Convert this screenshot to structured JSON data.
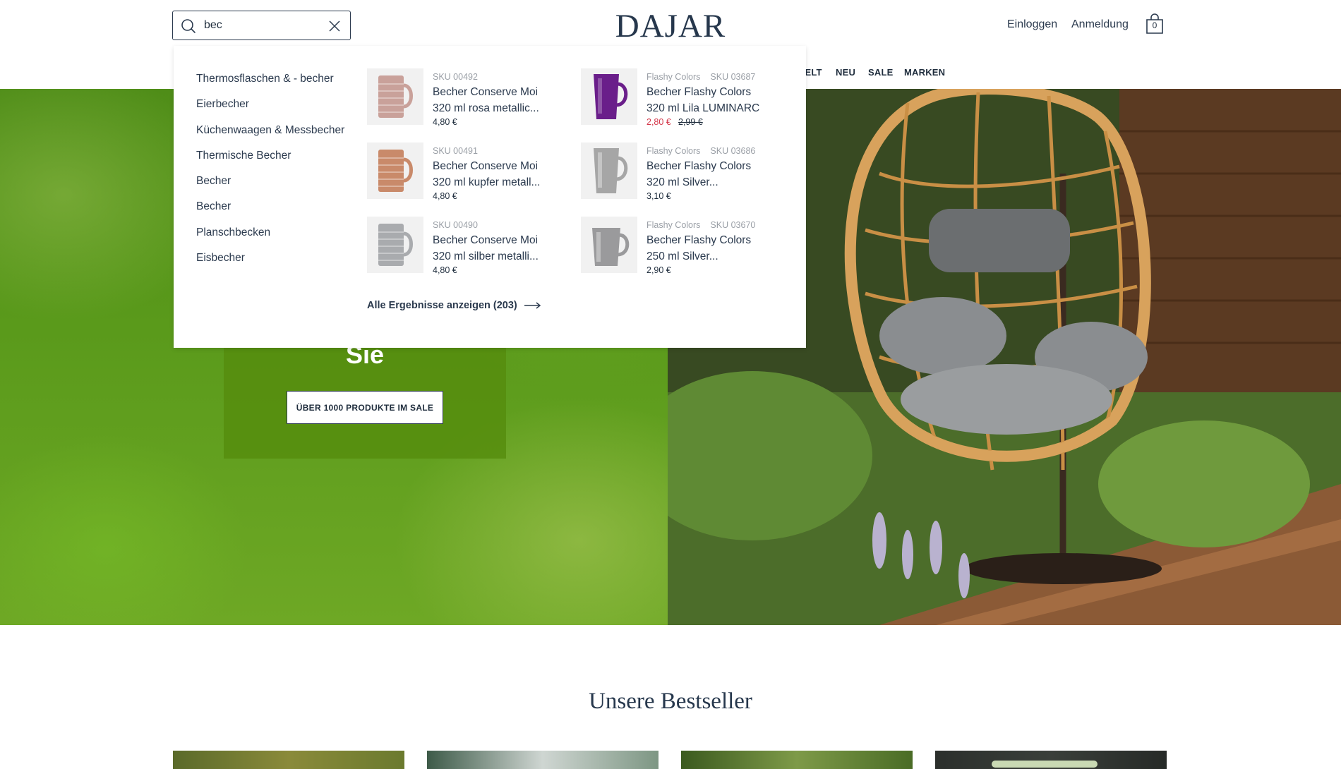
{
  "header": {
    "logo": "DAJAR",
    "search": {
      "value": "bec",
      "placeholder": ""
    },
    "login_label": "Einloggen",
    "register_label": "Anmeldung",
    "cart_count": "0",
    "nav": {
      "welt": "WELT",
      "neu": "NEU",
      "sale": "SALE",
      "marken": "MARKEN"
    }
  },
  "dropdown": {
    "categories": [
      "Thermosflaschen & - becher",
      "Eierbecher",
      "Küchenwaagen & Messbecher",
      "Thermische Becher",
      "Becher",
      "Becher",
      "Planschbecken",
      "Eisbecher"
    ],
    "products": [
      {
        "meta1": "SKU 00492",
        "meta2": "",
        "name": "Becher Conserve Moi 320 ml rosa metallic...",
        "price": "4,80 €",
        "old_price": "",
        "color": "#c9a19a"
      },
      {
        "meta1": "SKU 00491",
        "meta2": "",
        "name": "Becher Conserve Moi 320 ml kupfer metall...",
        "price": "4,80 €",
        "old_price": "",
        "color": "#c98a6a"
      },
      {
        "meta1": "SKU 00490",
        "meta2": "",
        "name": "Becher Conserve Moi 320 ml silber metalli...",
        "price": "4,80 €",
        "old_price": "",
        "color": "#a9abae"
      },
      {
        "meta1": "Flashy Colors",
        "meta2": "SKU 03687",
        "name": "Becher Flashy Colors 320 ml Lila LUMINARC",
        "price": "2,80 €",
        "old_price": "2,99 €",
        "color": "#6a1e8a"
      },
      {
        "meta1": "Flashy Colors",
        "meta2": "SKU 03686",
        "name": "Becher Flashy Colors 320 ml Silver...",
        "price": "3,10 €",
        "old_price": "",
        "color": "#a6a6a6"
      },
      {
        "meta1": "Flashy Colors",
        "meta2": "SKU 03670",
        "name": "Becher Flashy Colors 250 ml Silver...",
        "price": "2,90 €",
        "old_price": "",
        "color": "#9a9a9c"
      }
    ],
    "all_results": "Alle Ergebnisse anzeigen (203)"
  },
  "hero": {
    "title_visible": "Sie",
    "button": "ÜBER 1000 PRODUKTE IM SALE"
  },
  "bestseller": {
    "title": "Unsere Bestseller"
  },
  "colors": {
    "navy": "#2b3a4e",
    "sale_red": "#d4374a",
    "hero_green": "#5a9a1b"
  }
}
